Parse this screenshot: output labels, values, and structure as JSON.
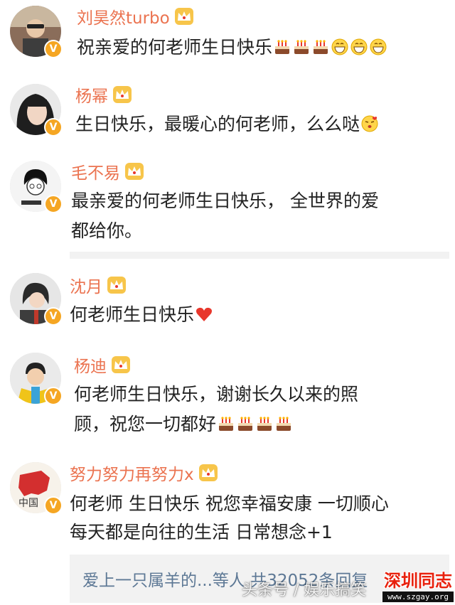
{
  "comments": [
    {
      "name": "刘昊然turbo",
      "lines": [
        "祝亲爱的何老师生日快乐"
      ],
      "emojis": [
        "cake-emoji",
        "cake-emoji",
        "cake-emoji",
        "grin-emoji",
        "grin-emoji",
        "grin-emoji"
      ],
      "verified": "V"
    },
    {
      "name": "杨幂",
      "lines": [
        "生日快乐，最暖心的何老师，么么哒"
      ],
      "emojis": [
        "kiss-emoji"
      ],
      "verified": "V"
    },
    {
      "name": "毛不易",
      "lines": [
        "最亲爱的何老师生日快乐，  全世界的爱",
        "都给你。"
      ],
      "emojis": [],
      "verified": "V"
    },
    {
      "name": "沈月",
      "lines": [
        "何老师生日快乐"
      ],
      "emojis": [
        "heart-emoji"
      ],
      "verified": "V"
    },
    {
      "name": "杨迪",
      "lines": [
        "何老师生日快乐，谢谢长久以来的照",
        "顾，祝您一切都好"
      ],
      "emojis": [
        "cake-emoji",
        "cake-emoji",
        "cake-emoji",
        "cake-emoji"
      ],
      "verified": "V"
    },
    {
      "name": "努力努力再努力x",
      "lines": [
        "何老师 生日快乐 祝您幸福安康 一切顺心",
        "每天都是向往的生活 日常想念+1"
      ],
      "emojis": [],
      "verified": "V"
    }
  ],
  "footer": {
    "link_text": "爱上一只属羊的...等人  共32052条回复"
  },
  "watermark": {
    "text": "头条号 / 娱乐搞笑"
  },
  "site_logo": {
    "title": "深圳同志",
    "url": "www.szgay.org"
  },
  "colors": {
    "name": "#eb7350",
    "text": "#222222",
    "link": "#5d7895",
    "badge": "#f5a623"
  }
}
